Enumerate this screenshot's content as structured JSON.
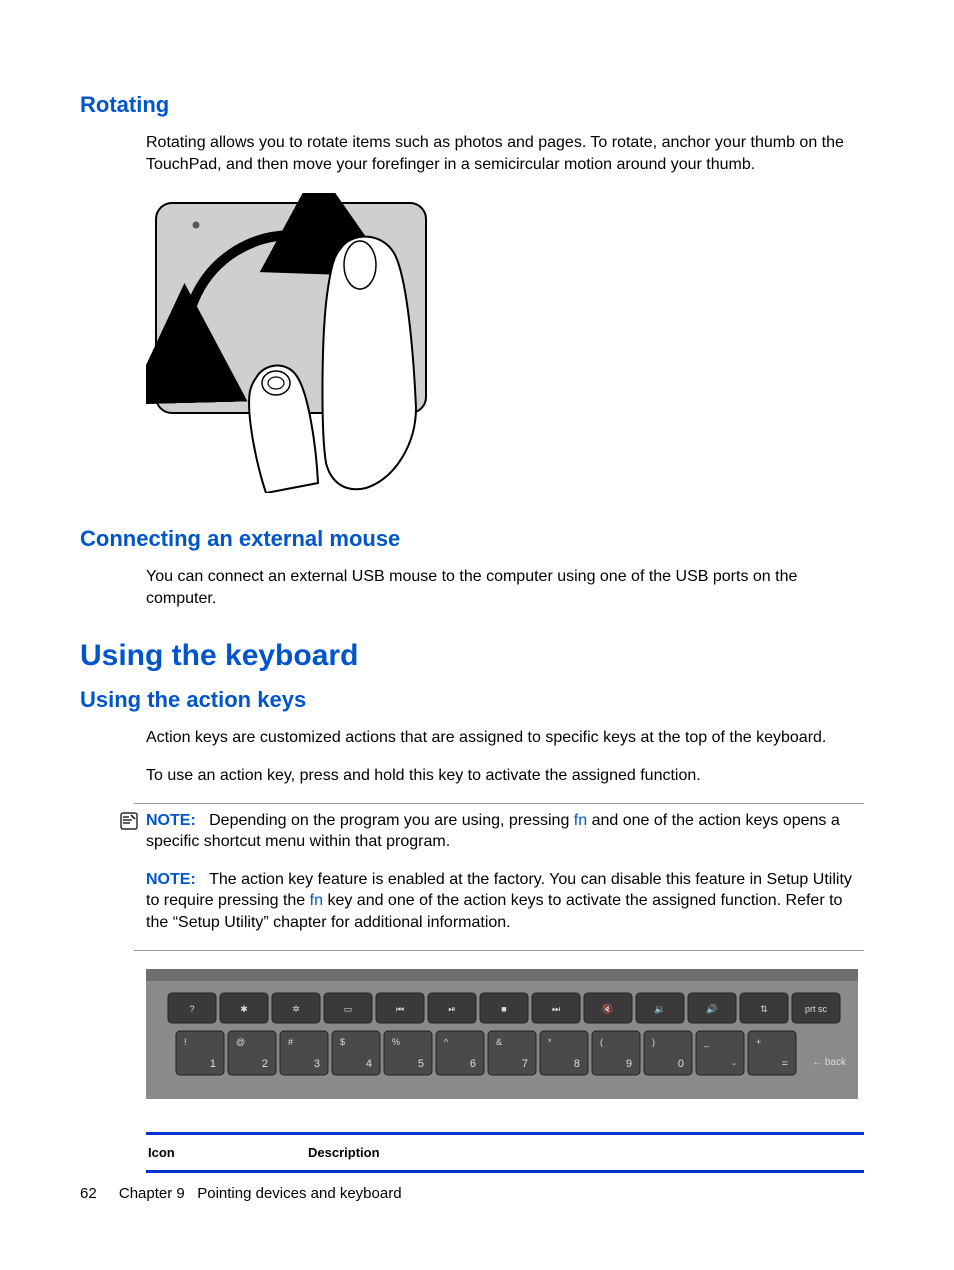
{
  "sections": {
    "rotating": {
      "heading": "Rotating",
      "para": "Rotating allows you to rotate items such as photos and pages. To rotate, anchor your thumb on the TouchPad, and then move your forefinger in a semicircular motion around your thumb."
    },
    "external_mouse": {
      "heading": "Connecting an external mouse",
      "para": "You can connect an external USB mouse to the computer using one of the USB ports on the computer."
    },
    "keyboard": {
      "heading": "Using the keyboard",
      "action_keys": {
        "heading": "Using the action keys",
        "para1": "Action keys are customized actions that are assigned to specific keys at the top of the keyboard.",
        "para2": "To use an action key, press and hold this key to activate the assigned function.",
        "note1_label": "NOTE:",
        "note1_before": "Depending on the program you are using, pressing ",
        "note1_fn": "fn",
        "note1_after": " and one of the action keys opens a specific shortcut menu within that program.",
        "note2_label": "NOTE:",
        "note2_before": "The action key feature is enabled at the factory. You can disable this feature in Setup Utility to require pressing the ",
        "note2_fn": "fn",
        "note2_after": " key and one of the action keys to activate the assigned function. Refer to the “Setup Utility” chapter for additional information."
      }
    }
  },
  "table": {
    "col_icon": "Icon",
    "col_desc": "Description"
  },
  "footer": {
    "page_number": "62",
    "chapter": "Chapter 9   Pointing devices and keyboard"
  },
  "keyboard_keys": {
    "row1": [
      "?",
      "✱",
      "✲",
      "▭",
      "⏮",
      "⏯",
      "■",
      "⏭",
      "🔇",
      "🔉",
      "🔊",
      "⇅",
      "prt sc"
    ],
    "row2": [
      {
        "top": "!",
        "bot": "1"
      },
      {
        "top": "@",
        "bot": "2"
      },
      {
        "top": "#",
        "bot": "3"
      },
      {
        "top": "$",
        "bot": "4"
      },
      {
        "top": "%",
        "bot": "5"
      },
      {
        "top": "^",
        "bot": "6"
      },
      {
        "top": "&",
        "bot": "7"
      },
      {
        "top": "*",
        "bot": "8"
      },
      {
        "top": "(",
        "bot": "9"
      },
      {
        "top": ")",
        "bot": "0"
      },
      {
        "top": "_",
        "bot": "-"
      },
      {
        "top": "+",
        "bot": "="
      }
    ],
    "backspace": "← back"
  }
}
